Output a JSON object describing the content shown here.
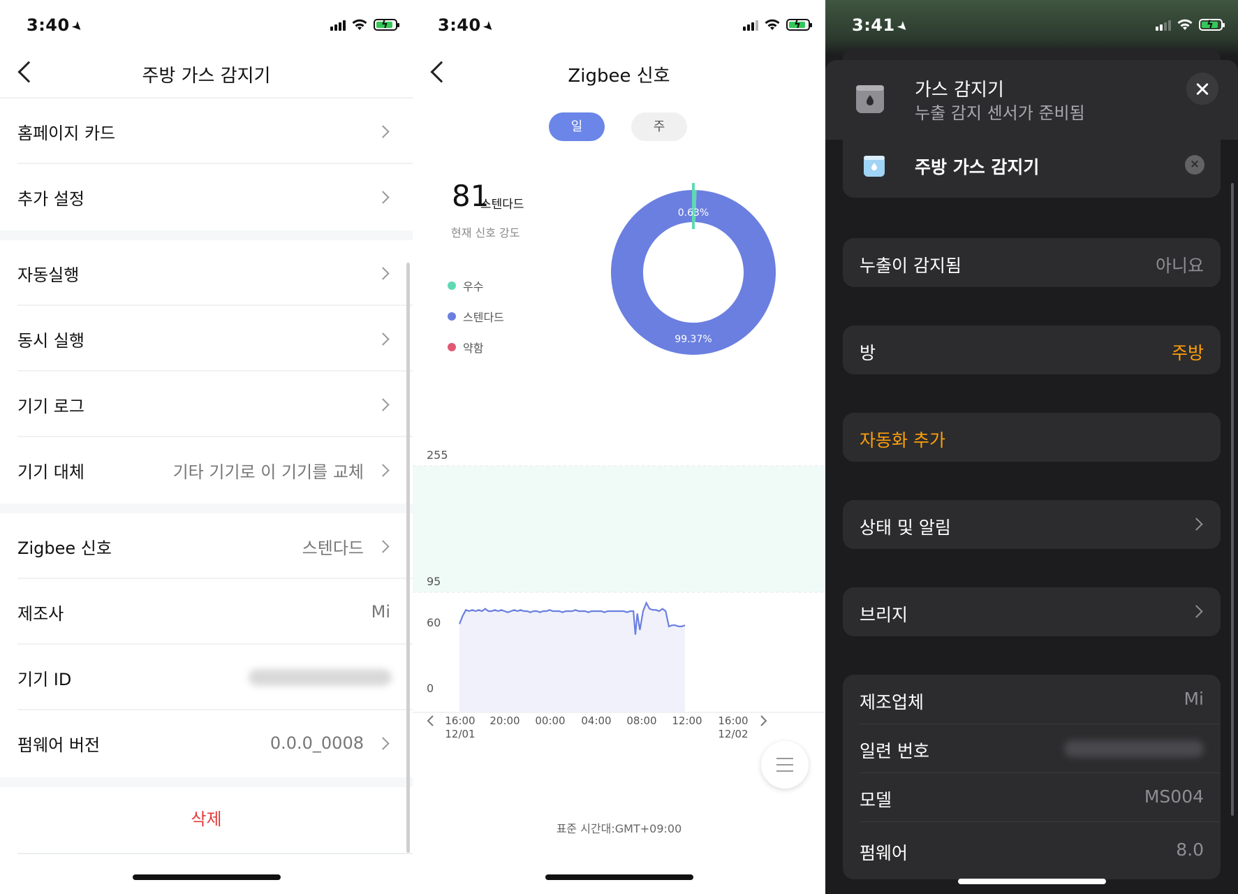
{
  "panel1": {
    "status": {
      "time": "3:40"
    },
    "nav": {
      "title": "주방 가스 감지기"
    },
    "rows": [
      {
        "label": "홈페이지 카드",
        "value": ""
      },
      {
        "label": "추가 설정",
        "value": ""
      },
      {
        "label": "자동실행",
        "value": ""
      },
      {
        "label": "동시 실행",
        "value": ""
      },
      {
        "label": "기기 로그",
        "value": ""
      },
      {
        "label": "기기 대체",
        "value": "기타 기기로 이 기기를 교체"
      },
      {
        "label": "Zigbee 신호",
        "value": "스텐다드"
      },
      {
        "label": "제조사",
        "value": "Mi"
      },
      {
        "label": "기기 ID",
        "value": ""
      },
      {
        "label": "펌웨어 버전",
        "value": "0.0.0_0008"
      }
    ],
    "delete_label": "삭제"
  },
  "panel2": {
    "status": {
      "time": "3:40"
    },
    "nav": {
      "title": "Zigbee 신호"
    },
    "tabs": {
      "day": "일",
      "week": "주"
    },
    "signal": {
      "value": "81",
      "unit": "스텐다드",
      "caption": "현재 신호 강도"
    },
    "legend": [
      {
        "label": "우수",
        "color": "#5fd9b4"
      },
      {
        "label": "스텐다드",
        "color": "#6b7fe0"
      },
      {
        "label": "약함",
        "color": "#e05a73"
      }
    ],
    "timezone": "표준 시간대:GMT+09:00",
    "chart_data": [
      {
        "type": "pie",
        "categories": [
          "우수",
          "스텐다드"
        ],
        "values": [
          0.63,
          99.37
        ],
        "data_labels": [
          "0.63%",
          "99.37%"
        ],
        "colors": [
          "#5fd9b4",
          "#6b7fe0"
        ]
      },
      {
        "type": "line",
        "yticks": [
          "255",
          "95",
          "60",
          "0"
        ],
        "ylim": [
          0,
          255
        ],
        "xticks": [
          {
            "time": "16:00",
            "date": "12/01"
          },
          {
            "time": "20:00",
            "date": ""
          },
          {
            "time": "00:00",
            "date": ""
          },
          {
            "time": "04:00",
            "date": ""
          },
          {
            "time": "08:00",
            "date": ""
          },
          {
            "time": "12:00",
            "date": ""
          },
          {
            "time": "16:00",
            "date": "12/02"
          }
        ],
        "bands": [
          {
            "from": 95,
            "to": 255,
            "color": "#f0fbf7"
          }
        ],
        "series": [
          {
            "color": "#6b7fe0",
            "x": [
              0,
              0.5,
              1,
              1.5,
              2,
              2.5,
              3,
              3.5,
              4,
              4.5,
              5,
              5.5,
              6,
              6.5,
              7,
              7.5,
              8,
              8.5,
              9,
              9.5,
              10,
              10.5,
              11,
              11.5,
              12,
              12.5,
              13,
              13.5,
              14,
              14.5,
              15,
              15.5,
              16,
              16.5,
              17,
              17.5,
              18,
              18.5,
              19,
              19.5,
              20,
              20.5,
              21,
              21.5,
              22,
              22.5,
              23,
              23.5,
              24,
              24.5,
              25,
              25.5,
              26,
              26.5,
              27,
              27.3,
              27.6,
              28,
              28.5,
              29,
              29.5,
              30,
              30.5,
              31,
              31.5,
              32,
              32.5,
              33,
              33.5,
              34,
              34.5,
              35
            ],
            "values": [
              68,
              75,
              80,
              79,
              80,
              79,
              80,
              79,
              81,
              79,
              79,
              80,
              79,
              80,
              79,
              78,
              79,
              80,
              79,
              80,
              79,
              79,
              78,
              79,
              79,
              78,
              79,
              79,
              80,
              79,
              79,
              79,
              78,
              79,
              79,
              79,
              80,
              79,
              79,
              79,
              78,
              79,
              79,
              79,
              79,
              78,
              79,
              79,
              79,
              79,
              79,
              79,
              78,
              79,
              79,
              59,
              77,
              63,
              79,
              86,
              81,
              80,
              80,
              79,
              81,
              79,
              66,
              67,
              67,
              66,
              66,
              67
            ]
          }
        ]
      }
    ]
  },
  "panel3": {
    "status": {
      "time": "3:41"
    },
    "header": {
      "title": "가스 감지기",
      "subtitle": "누출 감지 센서가 준비됨"
    },
    "device_name": "주방 가스 감지기",
    "leak": {
      "label": "누출이 감지됨",
      "value": "아니요"
    },
    "room": {
      "label": "방",
      "value": "주방"
    },
    "add_automation": "자동화 추가",
    "status_notifications": "상태 및 알림",
    "bridge": "브리지",
    "info": {
      "manufacturer_label": "제조업체",
      "manufacturer_value": "Mi",
      "serial_label": "일련 번호",
      "model_label": "모델",
      "model_value": "MS004",
      "firmware_label": "펌웨어",
      "firmware_value": "8.0"
    }
  }
}
